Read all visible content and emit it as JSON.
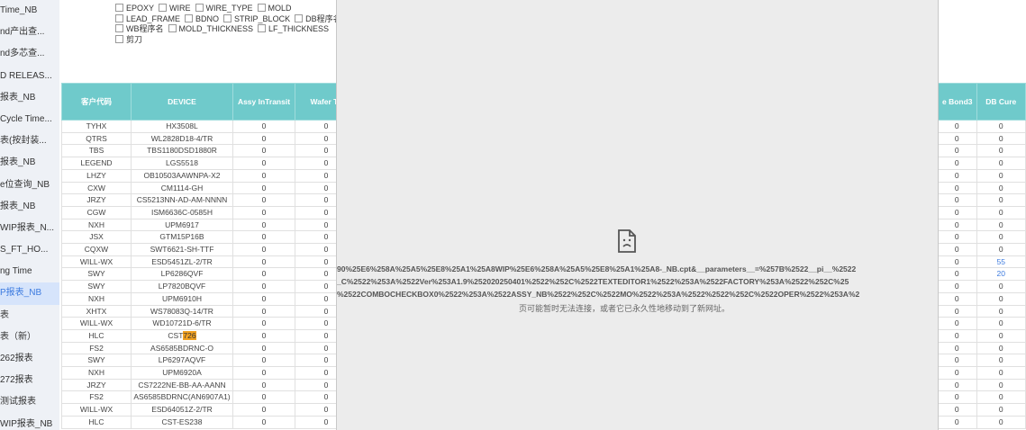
{
  "sidebar": {
    "items": [
      "Time_NB",
      "nd产出查...",
      "nd多芯查...",
      "D RELEAS...",
      "报表_NB",
      "Cycle Time...",
      "表(按封装...",
      "报表_NB",
      "e位查询_NB",
      "报表_NB",
      "WIP报表_N...",
      "S_FT_HO...",
      "ng Time",
      "P报表_NB",
      "表",
      "表（新）",
      "262报表",
      "272报表",
      "测试报表",
      "WIP报表_NB"
    ],
    "active_index": 13
  },
  "filters": {
    "row1": [
      {
        "label": "EPOXY"
      },
      {
        "label": "WIRE"
      },
      {
        "label": "WIRE_TYPE"
      },
      {
        "label": "MOLD"
      }
    ],
    "row2": [
      {
        "label": "LEAD_FRAME"
      },
      {
        "label": "BDNO"
      },
      {
        "label": "STRIP_BLOCK"
      },
      {
        "label": "DB程序名"
      }
    ],
    "row3": [
      {
        "label": "WB程序名"
      },
      {
        "label": "MOLD_THICKNESS"
      },
      {
        "label": "LF_THICKNESS"
      }
    ],
    "row4": [
      {
        "label": "剪刀"
      }
    ]
  },
  "table": {
    "headers": [
      "客户代码",
      "DEVICE",
      "Assy InTransit",
      "Wafer Ta"
    ],
    "right_headers": [
      "e Bond3",
      "DB Cure"
    ],
    "rows": [
      {
        "customer": "TYHX",
        "device": "HX3508L",
        "a": "0",
        "b": "0",
        "r1": "0",
        "r2": "0"
      },
      {
        "customer": "QTRS",
        "device": "WL2828D18-4/TR",
        "a": "0",
        "b": "0",
        "r1": "0",
        "r2": "0"
      },
      {
        "customer": "TBS",
        "device": "TBS1180DSD1880R",
        "a": "0",
        "b": "0",
        "r1": "0",
        "r2": "0"
      },
      {
        "customer": "LEGEND",
        "device": "LGS5518",
        "a": "0",
        "b": "0",
        "r1": "0",
        "r2": "0"
      },
      {
        "customer": "LHZY",
        "device": "OB10503AAWNPA-X2",
        "a": "0",
        "b": "0",
        "r1": "0",
        "r2": "0"
      },
      {
        "customer": "CXW",
        "device": "CM1114-GH",
        "a": "0",
        "b": "0",
        "r1": "0",
        "r2": "0"
      },
      {
        "customer": "JRZY",
        "device": "CS5213NN-AD-AM-NNNN",
        "a": "0",
        "b": "0",
        "r1": "0",
        "r2": "0"
      },
      {
        "customer": "CGW",
        "device": "ISM6636C-0585H",
        "a": "0",
        "b": "0",
        "r1": "0",
        "r2": "0"
      },
      {
        "customer": "NXH",
        "device": "UPM6917",
        "a": "0",
        "b": "0",
        "r1": "0",
        "r2": "0"
      },
      {
        "customer": "JSX",
        "device": "GTM15P16B",
        "a": "0",
        "b": "0",
        "r1": "0",
        "r2": "0"
      },
      {
        "customer": "CQXW",
        "device": "SWT6621-SH-TTF",
        "a": "0",
        "b": "0",
        "r1": "0",
        "r2": "0"
      },
      {
        "customer": "WILL-WX",
        "device": "ESD5451ZL-2/TR",
        "a": "0",
        "b": "0",
        "r1": "0",
        "r2": "55"
      },
      {
        "customer": "SWY",
        "device": "LP6286QVF",
        "a": "0",
        "b": "0",
        "r1": "0",
        "r2": "20"
      },
      {
        "customer": "SWY",
        "device": "LP7820BQVF",
        "a": "0",
        "b": "0",
        "r1": "0",
        "r2": "0"
      },
      {
        "customer": "NXH",
        "device": "UPM6910H",
        "a": "0",
        "b": "0",
        "r1": "0",
        "r2": "0"
      },
      {
        "customer": "XHTX",
        "device": "WS78083Q-14/TR",
        "a": "0",
        "b": "0",
        "r1": "0",
        "r2": "0"
      },
      {
        "customer": "WILL-WX",
        "device": "WD10721D-6/TR",
        "a": "0",
        "b": "0",
        "r1": "0",
        "r2": "0"
      },
      {
        "customer": "HLC",
        "device_prefix": "CST",
        "device_hl": "726",
        "a": "0",
        "b": "0",
        "r1": "0",
        "r2": "0"
      },
      {
        "customer": "FS2",
        "device": "AS6585BDRNC-O",
        "a": "0",
        "b": "0",
        "r1": "0",
        "r2": "0"
      },
      {
        "customer": "SWY",
        "device": "LP6297AQVF",
        "a": "0",
        "b": "0",
        "r1": "0",
        "r2": "0"
      },
      {
        "customer": "NXH",
        "device": "UPM6920A",
        "a": "0",
        "b": "0",
        "r1": "0",
        "r2": "0"
      },
      {
        "customer": "JRZY",
        "device": "CS7222NE-BB-AA-AANN",
        "a": "0",
        "b": "0",
        "r1": "0",
        "r2": "0"
      },
      {
        "customer": "FS2",
        "device": "AS6585BDRNC(AN6907A1)",
        "a": "0",
        "b": "0",
        "r1": "0",
        "r2": "0"
      },
      {
        "customer": "WILL-WX",
        "device": "ESD64051Z-2/TR",
        "a": "0",
        "b": "0",
        "r1": "0",
        "r2": "0"
      },
      {
        "customer": "HLC",
        "device": "CST-ES238",
        "a": "0",
        "b": "0",
        "r1": "0",
        "r2": "0"
      }
    ]
  },
  "error": {
    "icon": "broken-page-icon",
    "url_line1": "90%25E6%258A%25A5%25E8%25A1%25A8WIP%25E6%258A%25A5%25E8%25A1%25A8-_NB.cpt&__parameters__=%257B%2522__pi__%2522",
    "url_line2": "_C%2522%253A%2522Ver%253A1.9%252020250401%2522%252C%2522TEXTEDITOR1%2522%253A%2522FACTORY%253A%2522%252C%25",
    "url_line3": "%2522COMBOCHECKBOX0%2522%253A%2522ASSY_NB%2522%252C%2522MO%2522%253A%2522%2522%252C%2522OPER%2522%253A%2",
    "message": "页可能暂时无法连接，或者它已永久性地移动到了新网址。"
  }
}
